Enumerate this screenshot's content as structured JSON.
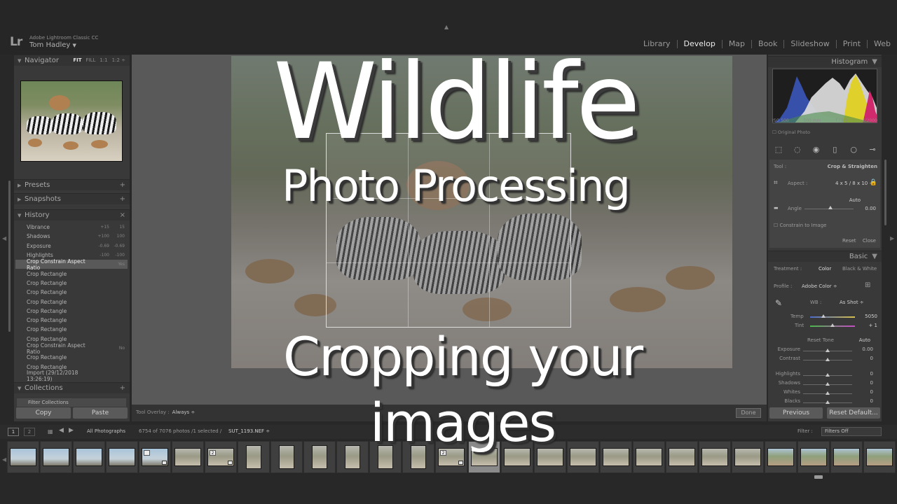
{
  "app": {
    "logo": "Lr",
    "name": "Adobe Lightroom Classic CC",
    "user": "Tom Hadley",
    "user_caret": "▼",
    "modules": [
      "Library",
      "Develop",
      "Map",
      "Book",
      "Slideshow",
      "Print",
      "Web"
    ],
    "active_module": "Develop"
  },
  "overlay_title": {
    "line1": "Wildlife",
    "line2": "Photo Processing",
    "line3": "Cropping your",
    "line4": "images"
  },
  "left_panel": {
    "navigator": {
      "title": "Navigator",
      "options": [
        "FIT",
        "FILL",
        "1:1",
        "1:2 ÷"
      ],
      "active_option": "FIT"
    },
    "presets": {
      "title": "Presets",
      "action": "+"
    },
    "snapshots": {
      "title": "Snapshots",
      "action": "+"
    },
    "history": {
      "title": "History",
      "action": "×",
      "items": [
        {
          "label": "Vibrance",
          "v1": "+15",
          "v2": "15"
        },
        {
          "label": "Shadows",
          "v1": "+100",
          "v2": "100"
        },
        {
          "label": "Exposure",
          "v1": "-0.69",
          "v2": "-0.69"
        },
        {
          "label": "Highlights",
          "v1": "-100",
          "v2": "-100"
        },
        {
          "label": "Crop Constrain Aspect Ratio",
          "v1": "",
          "v2": "Yes",
          "selected": true
        },
        {
          "label": "Crop Rectangle",
          "v1": "",
          "v2": ""
        },
        {
          "label": "Crop Rectangle",
          "v1": "",
          "v2": ""
        },
        {
          "label": "Crop Rectangle",
          "v1": "",
          "v2": ""
        },
        {
          "label": "Crop Rectangle",
          "v1": "",
          "v2": ""
        },
        {
          "label": "Crop Rectangle",
          "v1": "",
          "v2": ""
        },
        {
          "label": "Crop Rectangle",
          "v1": "",
          "v2": ""
        },
        {
          "label": "Crop Rectangle",
          "v1": "",
          "v2": ""
        },
        {
          "label": "Crop Rectangle",
          "v1": "",
          "v2": ""
        },
        {
          "label": "Crop Constrain Aspect Ratio",
          "v1": "",
          "v2": "No"
        },
        {
          "label": "Crop Rectangle",
          "v1": "",
          "v2": ""
        },
        {
          "label": "Crop Rectangle",
          "v1": "",
          "v2": ""
        },
        {
          "label": "Import (29/12/2018 13:26:19)",
          "v1": "",
          "v2": ""
        }
      ]
    },
    "collections": {
      "title": "Collections",
      "action": "+",
      "filter_label": "Filter Collections"
    },
    "copy_label": "Copy",
    "paste_label": "Paste"
  },
  "center": {
    "tool_overlay_label": "Tool Overlay :",
    "tool_overlay_value": "Always ÷",
    "done_label": "Done"
  },
  "right_panel": {
    "histogram": {
      "title": "Histogram",
      "iso": "ISO 500",
      "focal": "500 mm",
      "aperture": "f / 5.6",
      "shutter": "1/2000",
      "original_photo": "Original Photo"
    },
    "crop": {
      "tool_label": "Tool :",
      "tool_value": "Crop & Straighten",
      "aspect_label": "Aspect :",
      "aspect_value": "4 x 5 / 8 x 10 ÷",
      "auto_label": "Auto",
      "angle_label": "Angle",
      "angle_value": "0.00",
      "constrain_label": "Constrain to Image",
      "reset_label": "Reset",
      "close_label": "Close"
    },
    "basic": {
      "title": "Basic",
      "treatment_label": "Treatment :",
      "treatment_color": "Color",
      "treatment_bw": "Black & White",
      "profile_label": "Profile :",
      "profile_value": "Adobe Color ÷",
      "wb_label": "WB :",
      "wb_value": "As Shot ÷",
      "temp_label": "Temp",
      "temp_value": "5050",
      "tint_label": "Tint",
      "tint_value": "+ 1",
      "reset_tone": "Reset Tone",
      "auto": "Auto",
      "sliders": [
        {
          "label": "Exposure",
          "value": "0.00"
        },
        {
          "label": "Contrast",
          "value": "0"
        },
        {
          "label": "Highlights",
          "value": "0"
        },
        {
          "label": "Shadows",
          "value": "0"
        },
        {
          "label": "Whites",
          "value": "0"
        },
        {
          "label": "Blacks",
          "value": "0"
        }
      ]
    },
    "previous_label": "Previous",
    "reset_label": "Reset Default..."
  },
  "filmstrip": {
    "screen1": "1",
    "screen2": "2",
    "source": "All Photographs",
    "count": "6754 of 7076 photos /1 selected /",
    "filename": "SUT_1193.NEF ÷",
    "filter_label": "Filter :",
    "filter_value": "Filters Off",
    "selected_index": 14,
    "thumbs": [
      {
        "kind": "sky",
        "orient": "land"
      },
      {
        "kind": "sky",
        "orient": "land"
      },
      {
        "kind": "sky",
        "orient": "land"
      },
      {
        "kind": "sky",
        "orient": "land"
      },
      {
        "kind": "sky",
        "orient": "land",
        "badge": ""
      },
      {
        "kind": "bush",
        "orient": "land"
      },
      {
        "kind": "bush",
        "orient": "land",
        "badge": "2"
      },
      {
        "kind": "bush",
        "orient": "port"
      },
      {
        "kind": "bush",
        "orient": "port"
      },
      {
        "kind": "bush",
        "orient": "port"
      },
      {
        "kind": "bush",
        "orient": "port"
      },
      {
        "kind": "bush",
        "orient": "port"
      },
      {
        "kind": "bush",
        "orient": "port"
      },
      {
        "kind": "bush",
        "orient": "land",
        "badge": "2"
      },
      {
        "kind": "bush",
        "orient": "land"
      },
      {
        "kind": "bush",
        "orient": "land"
      },
      {
        "kind": "bush",
        "orient": "land"
      },
      {
        "kind": "bush",
        "orient": "land"
      },
      {
        "kind": "bush",
        "orient": "land"
      },
      {
        "kind": "bush",
        "orient": "land"
      },
      {
        "kind": "bush",
        "orient": "land"
      },
      {
        "kind": "bush",
        "orient": "land"
      },
      {
        "kind": "bush",
        "orient": "land"
      },
      {
        "kind": "road",
        "orient": "land"
      },
      {
        "kind": "road",
        "orient": "land"
      },
      {
        "kind": "road",
        "orient": "land"
      },
      {
        "kind": "road",
        "orient": "land"
      }
    ]
  }
}
